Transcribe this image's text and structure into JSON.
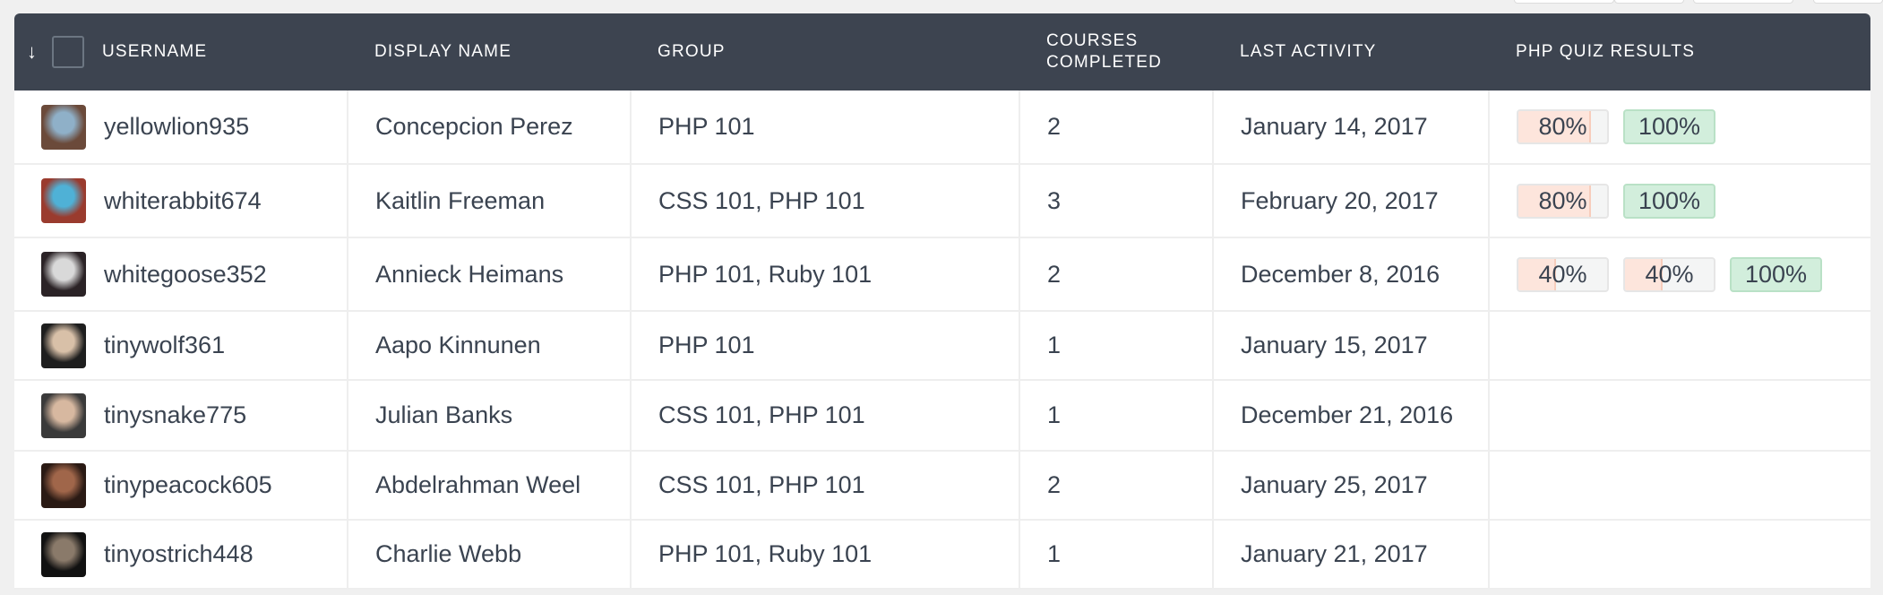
{
  "table": {
    "sort_icon": "↓",
    "columns": [
      {
        "label": "USERNAME"
      },
      {
        "label": "DISPLAY NAME"
      },
      {
        "label": "GROUP"
      },
      {
        "label": "COURSES COMPLETED"
      },
      {
        "label": "LAST ACTIVITY"
      },
      {
        "label": "PHP QUIZ RESULTS"
      }
    ],
    "rows": [
      {
        "username": "yellowlion935",
        "display_name": "Concepcion Perez",
        "group": "PHP 101",
        "courses_completed": "2",
        "last_activity": "January 14, 2017",
        "avatar_colors": [
          "#6b4a3a",
          "#8fb0c8"
        ],
        "quiz_results": [
          {
            "label": "80%",
            "value": 80
          },
          {
            "label": "100%",
            "value": 100
          }
        ]
      },
      {
        "username": "whiterabbit674",
        "display_name": "Kaitlin Freeman",
        "group": "CSS 101, PHP 101",
        "courses_completed": "3",
        "last_activity": "February 20, 2017",
        "avatar_colors": [
          "#9a3b2e",
          "#4fb1d6"
        ],
        "quiz_results": [
          {
            "label": "80%",
            "value": 80
          },
          {
            "label": "100%",
            "value": 100
          }
        ]
      },
      {
        "username": "whitegoose352",
        "display_name": "Annieck Heimans",
        "group": "PHP 101, Ruby 101",
        "courses_completed": "2",
        "last_activity": "December 8, 2016",
        "avatar_colors": [
          "#2b2326",
          "#d9d9d9"
        ],
        "quiz_results": [
          {
            "label": "40%",
            "value": 40
          },
          {
            "label": "40%",
            "value": 40
          },
          {
            "label": "100%",
            "value": 100
          }
        ]
      },
      {
        "username": "tinywolf361",
        "display_name": "Aapo Kinnunen",
        "group": "PHP 101",
        "courses_completed": "1",
        "last_activity": "January 15, 2017",
        "avatar_colors": [
          "#1e1e1e",
          "#d8c0a8"
        ],
        "quiz_results": []
      },
      {
        "username": "tinysnake775",
        "display_name": "Julian Banks",
        "group": "CSS 101, PHP 101",
        "courses_completed": "1",
        "last_activity": "December 21, 2016",
        "avatar_colors": [
          "#3a3a3a",
          "#d7b8a0"
        ],
        "quiz_results": []
      },
      {
        "username": "tinypeacock605",
        "display_name": "Abdelrahman Weel",
        "group": "CSS 101, PHP 101",
        "courses_completed": "2",
        "last_activity": "January 25, 2017",
        "avatar_colors": [
          "#2a1a14",
          "#a0664a"
        ],
        "quiz_results": []
      },
      {
        "username": "tinyostrich448",
        "display_name": "Charlie Webb",
        "group": "PHP 101, Ruby 101",
        "courses_completed": "1",
        "last_activity": "January 21, 2017",
        "avatar_colors": [
          "#111111",
          "#8a7a6a"
        ],
        "quiz_results": []
      }
    ]
  },
  "colors": {
    "header_bg": "#3d4450",
    "fail_fill": "#fde5dc",
    "pass_fill": "#d2eedc",
    "text": "#3a4350"
  }
}
